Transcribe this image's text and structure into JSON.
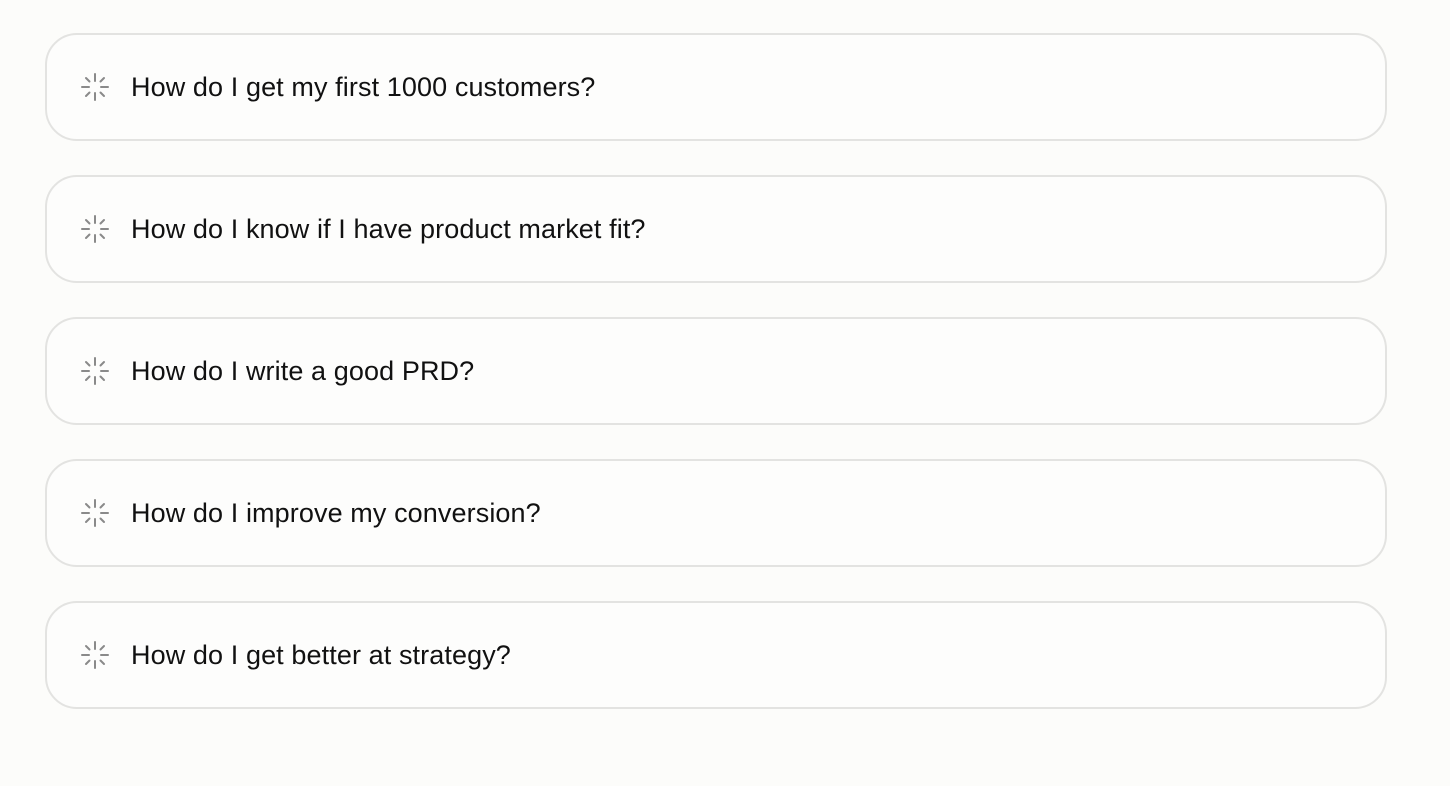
{
  "suggestions": {
    "icon": "loading-spinner-icon",
    "items": [
      {
        "label": "How do I get my first 1000 customers?"
      },
      {
        "label": "How do I know if I have product market fit?"
      },
      {
        "label": "How do I write a good PRD?"
      },
      {
        "label": "How do I improve my conversion?"
      },
      {
        "label": "How do I get better at strategy?"
      }
    ]
  },
  "colors": {
    "background": "#fcfcfa",
    "card_border": "#e3e3e1",
    "text": "#111111",
    "icon": "#8a8a8a"
  }
}
